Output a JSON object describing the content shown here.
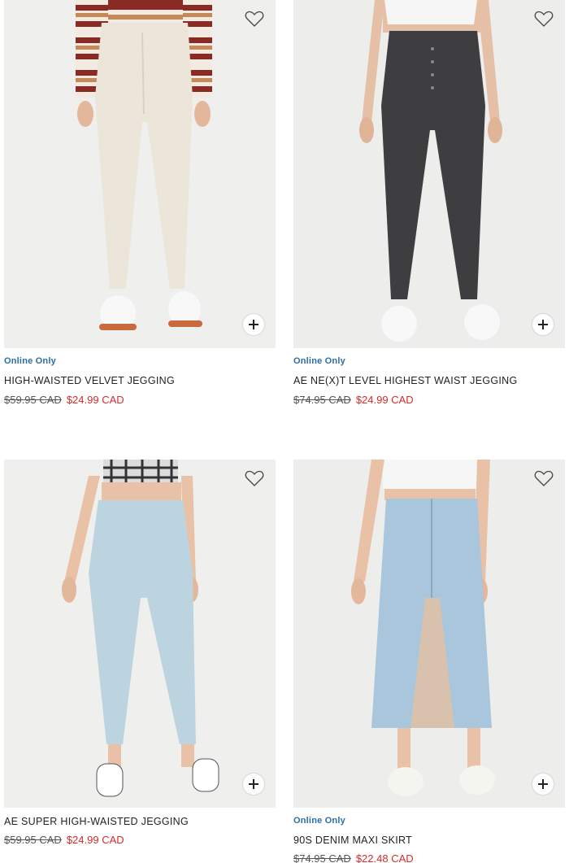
{
  "products": [
    {
      "badge": "Online Only",
      "name": "HIGH-WAISTED VELVET JEGGING",
      "original_price": "$59.95 CAD",
      "sale_price": "$24.99 CAD",
      "jean_color": "#ece6da",
      "top": "striped sweater"
    },
    {
      "badge": "Online Only",
      "name": "AE NE(X)T LEVEL HIGHEST WAIST JEGGING",
      "original_price": "$74.95 CAD",
      "sale_price": "$24.99 CAD",
      "jean_color": "#3e3e40",
      "top": "white crop top"
    },
    {
      "badge": "",
      "name": "AE SUPER HIGH-WAISTED JEGGING",
      "original_price": "$59.95 CAD",
      "sale_price": "$24.99 CAD",
      "jean_color": "#bcd4e0",
      "top": "plaid crop top"
    },
    {
      "badge": "Online Only",
      "name": "90S DENIM MAXI SKIRT",
      "original_price": "$74.95 CAD",
      "sale_price": "$22.48 CAD",
      "jean_color": "#a9c6dd",
      "top": "white crop top"
    }
  ],
  "colors": {
    "badge": "#2e6ea6",
    "sale": "#d52b2b",
    "image_bg": "#efefee"
  },
  "icons": [
    "heart-icon",
    "plus-icon"
  ]
}
